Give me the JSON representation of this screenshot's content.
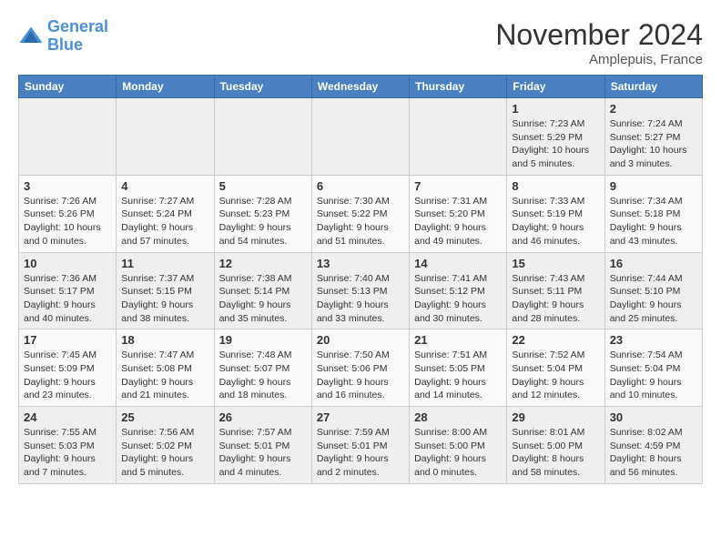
{
  "header": {
    "logo_line1": "General",
    "logo_line2": "Blue",
    "month": "November 2024",
    "location": "Amplepuis, France"
  },
  "weekdays": [
    "Sunday",
    "Monday",
    "Tuesday",
    "Wednesday",
    "Thursday",
    "Friday",
    "Saturday"
  ],
  "weeks": [
    [
      {
        "day": "",
        "info": ""
      },
      {
        "day": "",
        "info": ""
      },
      {
        "day": "",
        "info": ""
      },
      {
        "day": "",
        "info": ""
      },
      {
        "day": "",
        "info": ""
      },
      {
        "day": "1",
        "info": "Sunrise: 7:23 AM\nSunset: 5:29 PM\nDaylight: 10 hours\nand 5 minutes."
      },
      {
        "day": "2",
        "info": "Sunrise: 7:24 AM\nSunset: 5:27 PM\nDaylight: 10 hours\nand 3 minutes."
      }
    ],
    [
      {
        "day": "3",
        "info": "Sunrise: 7:26 AM\nSunset: 5:26 PM\nDaylight: 10 hours\nand 0 minutes."
      },
      {
        "day": "4",
        "info": "Sunrise: 7:27 AM\nSunset: 5:24 PM\nDaylight: 9 hours\nand 57 minutes."
      },
      {
        "day": "5",
        "info": "Sunrise: 7:28 AM\nSunset: 5:23 PM\nDaylight: 9 hours\nand 54 minutes."
      },
      {
        "day": "6",
        "info": "Sunrise: 7:30 AM\nSunset: 5:22 PM\nDaylight: 9 hours\nand 51 minutes."
      },
      {
        "day": "7",
        "info": "Sunrise: 7:31 AM\nSunset: 5:20 PM\nDaylight: 9 hours\nand 49 minutes."
      },
      {
        "day": "8",
        "info": "Sunrise: 7:33 AM\nSunset: 5:19 PM\nDaylight: 9 hours\nand 46 minutes."
      },
      {
        "day": "9",
        "info": "Sunrise: 7:34 AM\nSunset: 5:18 PM\nDaylight: 9 hours\nand 43 minutes."
      }
    ],
    [
      {
        "day": "10",
        "info": "Sunrise: 7:36 AM\nSunset: 5:17 PM\nDaylight: 9 hours\nand 40 minutes."
      },
      {
        "day": "11",
        "info": "Sunrise: 7:37 AM\nSunset: 5:15 PM\nDaylight: 9 hours\nand 38 minutes."
      },
      {
        "day": "12",
        "info": "Sunrise: 7:38 AM\nSunset: 5:14 PM\nDaylight: 9 hours\nand 35 minutes."
      },
      {
        "day": "13",
        "info": "Sunrise: 7:40 AM\nSunset: 5:13 PM\nDaylight: 9 hours\nand 33 minutes."
      },
      {
        "day": "14",
        "info": "Sunrise: 7:41 AM\nSunset: 5:12 PM\nDaylight: 9 hours\nand 30 minutes."
      },
      {
        "day": "15",
        "info": "Sunrise: 7:43 AM\nSunset: 5:11 PM\nDaylight: 9 hours\nand 28 minutes."
      },
      {
        "day": "16",
        "info": "Sunrise: 7:44 AM\nSunset: 5:10 PM\nDaylight: 9 hours\nand 25 minutes."
      }
    ],
    [
      {
        "day": "17",
        "info": "Sunrise: 7:45 AM\nSunset: 5:09 PM\nDaylight: 9 hours\nand 23 minutes."
      },
      {
        "day": "18",
        "info": "Sunrise: 7:47 AM\nSunset: 5:08 PM\nDaylight: 9 hours\nand 21 minutes."
      },
      {
        "day": "19",
        "info": "Sunrise: 7:48 AM\nSunset: 5:07 PM\nDaylight: 9 hours\nand 18 minutes."
      },
      {
        "day": "20",
        "info": "Sunrise: 7:50 AM\nSunset: 5:06 PM\nDaylight: 9 hours\nand 16 minutes."
      },
      {
        "day": "21",
        "info": "Sunrise: 7:51 AM\nSunset: 5:05 PM\nDaylight: 9 hours\nand 14 minutes."
      },
      {
        "day": "22",
        "info": "Sunrise: 7:52 AM\nSunset: 5:04 PM\nDaylight: 9 hours\nand 12 minutes."
      },
      {
        "day": "23",
        "info": "Sunrise: 7:54 AM\nSunset: 5:04 PM\nDaylight: 9 hours\nand 10 minutes."
      }
    ],
    [
      {
        "day": "24",
        "info": "Sunrise: 7:55 AM\nSunset: 5:03 PM\nDaylight: 9 hours\nand 7 minutes."
      },
      {
        "day": "25",
        "info": "Sunrise: 7:56 AM\nSunset: 5:02 PM\nDaylight: 9 hours\nand 5 minutes."
      },
      {
        "day": "26",
        "info": "Sunrise: 7:57 AM\nSunset: 5:01 PM\nDaylight: 9 hours\nand 4 minutes."
      },
      {
        "day": "27",
        "info": "Sunrise: 7:59 AM\nSunset: 5:01 PM\nDaylight: 9 hours\nand 2 minutes."
      },
      {
        "day": "28",
        "info": "Sunrise: 8:00 AM\nSunset: 5:00 PM\nDaylight: 9 hours\nand 0 minutes."
      },
      {
        "day": "29",
        "info": "Sunrise: 8:01 AM\nSunset: 5:00 PM\nDaylight: 8 hours\nand 58 minutes."
      },
      {
        "day": "30",
        "info": "Sunrise: 8:02 AM\nSunset: 4:59 PM\nDaylight: 8 hours\nand 56 minutes."
      }
    ]
  ]
}
